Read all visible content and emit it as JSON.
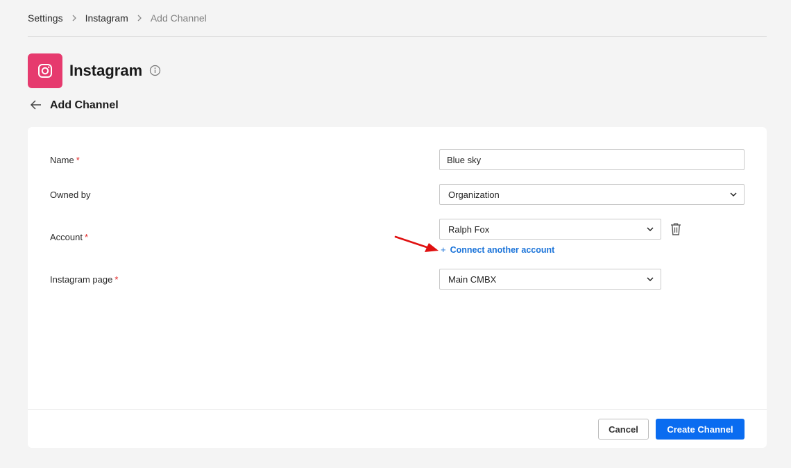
{
  "breadcrumb": {
    "items": [
      "Settings",
      "Instagram",
      "Add Channel"
    ]
  },
  "header": {
    "title": "Instagram",
    "logo_icon": "instagram-icon",
    "brand_color": "#e63a6e"
  },
  "section": {
    "title": "Add Channel"
  },
  "form": {
    "name_label": "Name",
    "name_value": "Blue sky",
    "owned_by_label": "Owned by",
    "owned_by_value": "Organization",
    "account_label": "Account",
    "account_value": "Ralph Fox",
    "connect_link": "Connect another account",
    "instagram_page_label": "Instagram page",
    "instagram_page_value": "Main CMBX",
    "required_marker": "*"
  },
  "footer": {
    "cancel_label": "Cancel",
    "create_label": "Create Channel",
    "accent_color": "#0a6cf0"
  }
}
